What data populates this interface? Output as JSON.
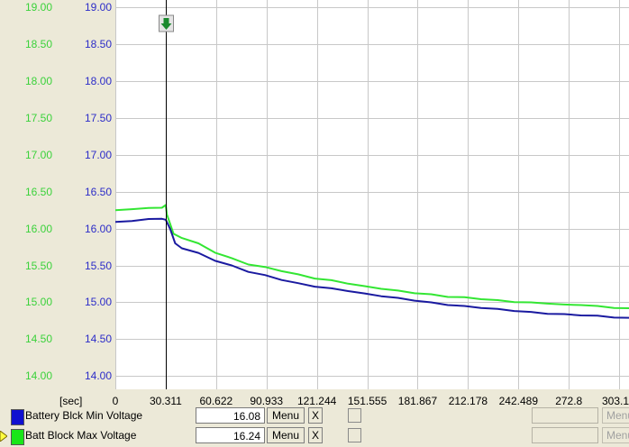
{
  "chart_data": {
    "type": "line",
    "y_left": {
      "ticks": [
        "19.00",
        "18.50",
        "18.00",
        "17.50",
        "17.00",
        "16.50",
        "16.00",
        "15.50",
        "15.00",
        "14.50",
        "14.00"
      ],
      "color": "#3bd23b"
    },
    "y_right": {
      "ticks": [
        "19.00",
        "18.50",
        "18.00",
        "17.50",
        "17.00",
        "16.50",
        "16.00",
        "15.50",
        "15.00",
        "14.50",
        "14.00"
      ],
      "color": "#2c2cc8"
    },
    "ylim": [
      13.82,
      19.1
    ],
    "x_unit": "[sec]",
    "x_ticks": [
      "0",
      "30.311",
      "60.622",
      "90.933",
      "121.244",
      "151.555",
      "181.867",
      "212.178",
      "242.489",
      "272.8",
      "303.1"
    ],
    "xlim": [
      0,
      309
    ],
    "cursor_x": 30.311,
    "grid": true,
    "series": [
      {
        "name": "Batt Block Max Voltage",
        "color": "#33e633",
        "x": [
          0,
          10,
          20,
          28,
          30.3,
          31,
          35,
          40,
          50,
          60,
          70,
          80,
          90,
          100,
          110,
          120,
          130,
          140,
          150,
          160,
          170,
          180,
          190,
          200,
          210,
          220,
          230,
          240,
          250,
          260,
          270,
          280,
          290,
          300,
          309
        ],
        "y": [
          16.25,
          16.27,
          16.28,
          16.29,
          16.32,
          16.2,
          15.93,
          15.88,
          15.8,
          15.68,
          15.6,
          15.52,
          15.48,
          15.43,
          15.38,
          15.33,
          15.3,
          15.26,
          15.22,
          15.19,
          15.16,
          15.13,
          15.11,
          15.08,
          15.07,
          15.05,
          15.03,
          15.01,
          15.0,
          14.99,
          14.97,
          14.97,
          14.95,
          14.93,
          14.92
        ]
      },
      {
        "name": "Battery Blck Min Voltage",
        "color": "#1a1aa0",
        "x": [
          0,
          10,
          20,
          28,
          30.3,
          33,
          36,
          40,
          50,
          60,
          70,
          80,
          90,
          100,
          110,
          120,
          130,
          140,
          150,
          160,
          170,
          180,
          190,
          200,
          210,
          220,
          230,
          240,
          250,
          260,
          270,
          280,
          290,
          300,
          309
        ],
        "y": [
          16.09,
          16.11,
          16.13,
          16.14,
          16.12,
          16.0,
          15.8,
          15.74,
          15.67,
          15.57,
          15.5,
          15.42,
          15.37,
          15.31,
          15.26,
          15.22,
          15.19,
          15.16,
          15.12,
          15.09,
          15.06,
          15.03,
          15.0,
          14.97,
          14.95,
          14.93,
          14.91,
          14.89,
          14.87,
          14.85,
          14.84,
          14.83,
          14.82,
          14.8,
          14.79
        ]
      }
    ]
  },
  "legend": [
    {
      "name": "Battery Blck Min Voltage",
      "color": "#1010d0",
      "value": "16.08",
      "menu_label": "Menu",
      "close_label": "X",
      "selected": false
    },
    {
      "name": "Batt Block Max Voltage",
      "color": "#19e619",
      "value": "16.24",
      "menu_label": "Menu",
      "close_label": "X",
      "selected": true
    }
  ],
  "extra_button_label": "Menu",
  "icons": {
    "cursor_marker": "down-arrow-icon",
    "selection_pointer": "triangle-pointer-icon"
  }
}
